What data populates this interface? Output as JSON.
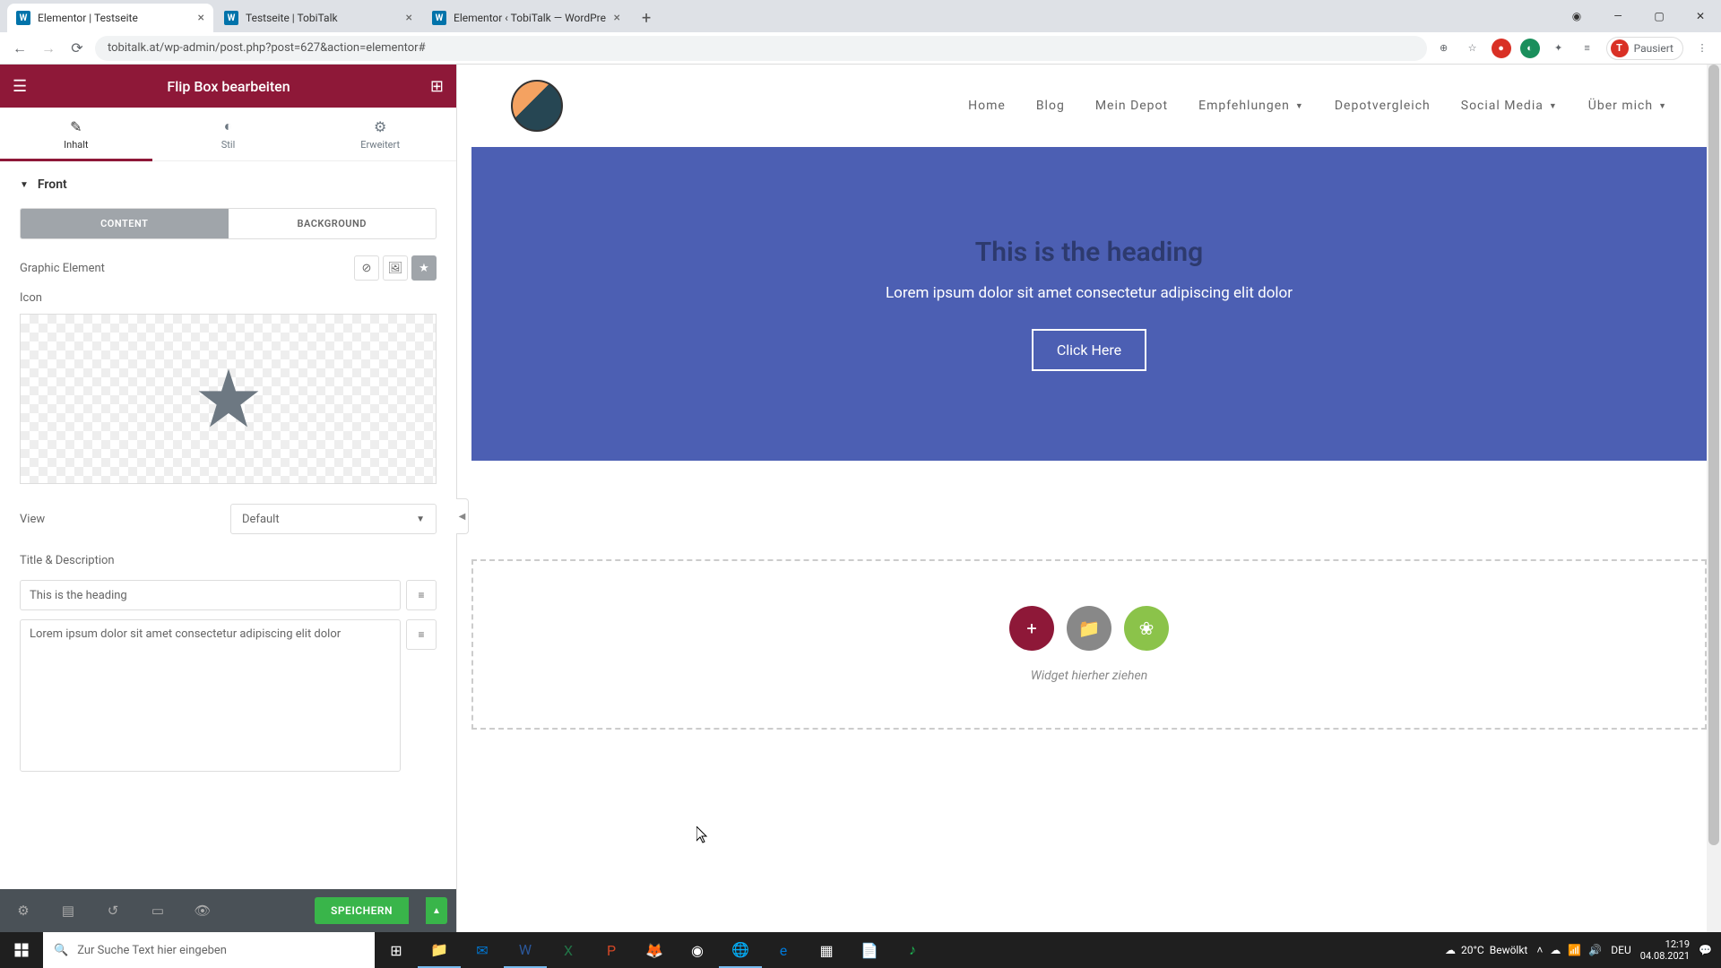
{
  "browser": {
    "tabs": [
      {
        "title": "Elementor | Testseite",
        "active": true
      },
      {
        "title": "Testseite | TobiTalk",
        "active": false
      },
      {
        "title": "Elementor ‹ TobiTalk — WordPre",
        "active": false
      }
    ],
    "url": "tobitalk.at/wp-admin/post.php?post=627&action=elementor#",
    "profile_status": "Pausiert"
  },
  "panel": {
    "title": "Flip Box bearbeiten",
    "tabs": {
      "content": "Inhalt",
      "style": "Stil",
      "advanced": "Erweitert"
    },
    "section_front": "Front",
    "subtabs": {
      "content": "CONTENT",
      "background": "BACKGROUND"
    },
    "graphic_element_label": "Graphic Element",
    "icon_label": "Icon",
    "view_label": "View",
    "view_value": "Default",
    "title_desc_label": "Title & Description",
    "title_value": "This is the heading",
    "description_value": "Lorem ipsum dolor sit amet consectetur adipiscing elit dolor",
    "save_button": "SPEICHERN"
  },
  "preview": {
    "nav": {
      "home": "Home",
      "blog": "Blog",
      "depot": "Mein Depot",
      "empfehlungen": "Empfehlungen",
      "depotvergleich": "Depotvergleich",
      "social": "Social Media",
      "about": "Über mich"
    },
    "flipbox": {
      "heading": "This is the heading",
      "text": "Lorem ipsum dolor sit amet consectetur adipiscing elit dolor",
      "button": "Click Here"
    },
    "drag_text": "Widget hierher ziehen"
  },
  "taskbar": {
    "search_placeholder": "Zur Suche Text hier eingeben",
    "weather_temp": "20°C",
    "weather_desc": "Bewölkt",
    "lang": "DEU",
    "time": "12:19",
    "date": "04.08.2021"
  }
}
